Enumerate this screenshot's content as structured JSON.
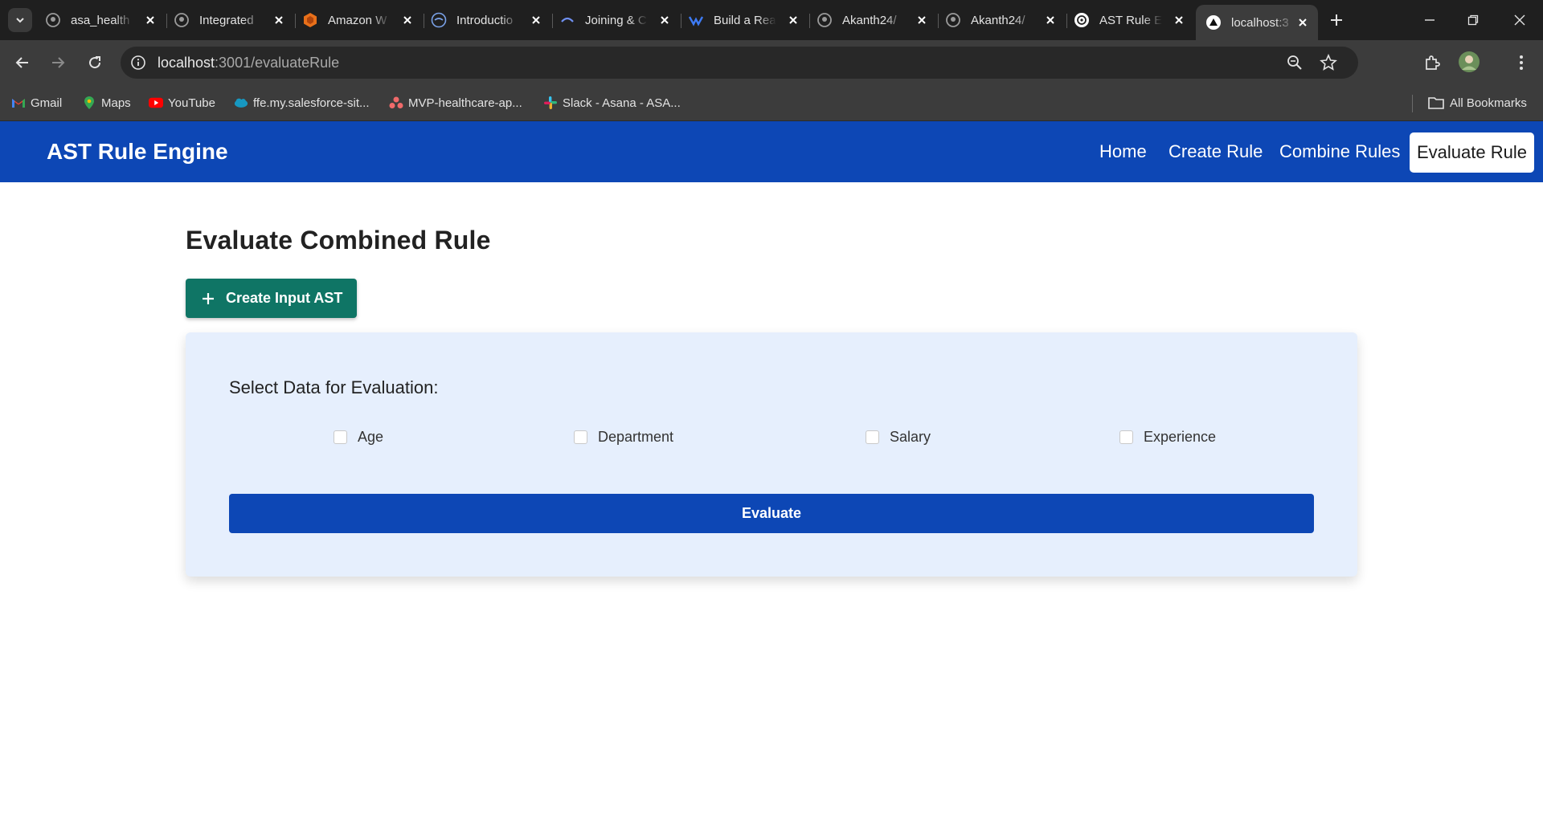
{
  "browser": {
    "tabs": [
      {
        "title": "asa_health",
        "icon": "github-icon"
      },
      {
        "title": "Integrated",
        "icon": "github-icon"
      },
      {
        "title": "Amazon W",
        "icon": "aws-icon"
      },
      {
        "title": "Introductio",
        "icon": "site-icon"
      },
      {
        "title": "Joining & C",
        "icon": "site-icon"
      },
      {
        "title": "Build a Rea",
        "icon": "site-icon"
      },
      {
        "title": "Akanth24/",
        "icon": "github-icon"
      },
      {
        "title": "Akanth24/",
        "icon": "github-icon"
      },
      {
        "title": "AST Rule E",
        "icon": "openai-icon"
      },
      {
        "title": "localhost:3",
        "icon": "vercel-icon",
        "active": true
      }
    ],
    "url_host": "localhost",
    "url_rest": ":3001/evaluateRule",
    "bookmarks": [
      {
        "label": "Gmail",
        "icon": "gmail-icon"
      },
      {
        "label": "Maps",
        "icon": "maps-icon"
      },
      {
        "label": "YouTube",
        "icon": "youtube-icon"
      },
      {
        "label": "ffe.my.salesforce-sit...",
        "icon": "salesforce-icon"
      },
      {
        "label": "MVP-healthcare-ap...",
        "icon": "asana-icon"
      },
      {
        "label": "Slack - Asana - ASA...",
        "icon": "slack-icon"
      }
    ],
    "all_bookmarks": "All Bookmarks"
  },
  "app": {
    "brand": "AST Rule Engine",
    "nav": [
      "Home",
      "Create Rule",
      "Combine Rules",
      "Evaluate Rule"
    ],
    "active_nav": "Evaluate Rule",
    "colors": {
      "primary": "#0d47b5",
      "success": "#0f7565",
      "panel": "#e6effd"
    }
  },
  "main": {
    "title": "Evaluate Combined Rule",
    "create_button": "Create Input AST",
    "panel_title": "Select Data for Evaluation:",
    "options": [
      {
        "label": "Age",
        "checked": false
      },
      {
        "label": "Department",
        "checked": false
      },
      {
        "label": "Salary",
        "checked": false
      },
      {
        "label": "Experience",
        "checked": false
      }
    ],
    "evaluate_button": "Evaluate"
  }
}
